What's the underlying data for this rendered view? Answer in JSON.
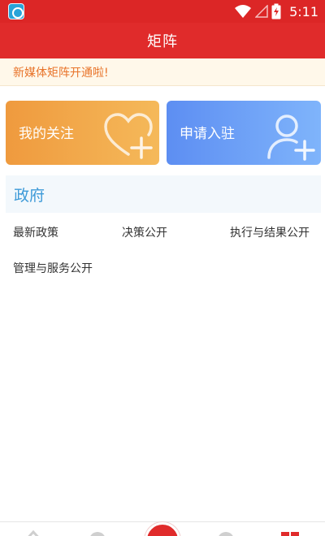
{
  "status_bar": {
    "time": "5:11",
    "icons": [
      "app-logo-icon",
      "wifi-icon",
      "signal-icon",
      "battery-charging-icon"
    ]
  },
  "header": {
    "title": "矩阵"
  },
  "notice": {
    "text": "新媒体矩阵开通啦!"
  },
  "cards": {
    "follow": {
      "label": "我的关注",
      "icon": "heart-plus-icon"
    },
    "apply": {
      "label": "申请入驻",
      "icon": "user-plus-icon"
    }
  },
  "section": {
    "title": "政府"
  },
  "links": [
    {
      "label": "最新政策"
    },
    {
      "label": "决策公开"
    },
    {
      "label": "执行与结果公开"
    },
    {
      "label": "管理与服务公开"
    }
  ],
  "bottom_nav": {
    "icons": [
      "home-icon",
      "nav-icon-2",
      "center-add-icon",
      "nav-icon-4",
      "grid-icon"
    ]
  },
  "colors": {
    "primary_red": "#e02b2b",
    "notice_orange": "#e8742a",
    "section_blue": "#3d9ad8",
    "card_orange": "#f5b95a",
    "card_blue": "#7fb4fb"
  }
}
